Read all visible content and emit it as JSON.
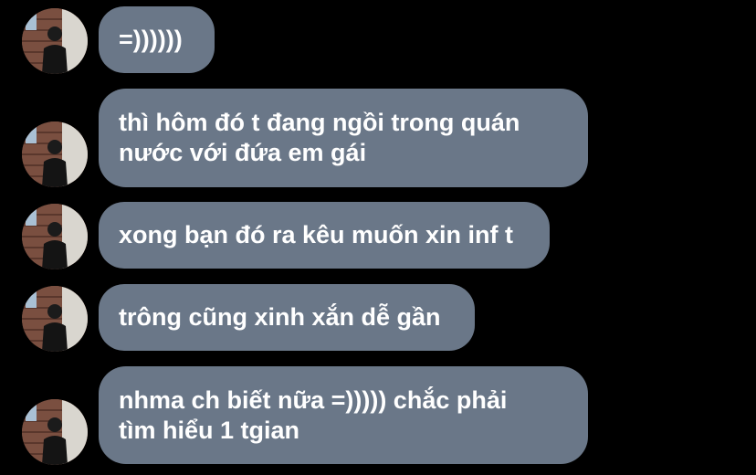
{
  "colors": {
    "background": "#000000",
    "bubble": "#6a7788",
    "text": "#ffffff"
  },
  "messages": [
    {
      "text": "=))))))",
      "avatar": "user-avatar"
    },
    {
      "text": "thì hôm đó t đang ngồi trong quán\nnước với đứa em gái",
      "avatar": "user-avatar"
    },
    {
      "text": "xong bạn đó ra kêu muốn xin inf t",
      "avatar": "user-avatar"
    },
    {
      "text": "trông cũng xinh xắn dễ gần",
      "avatar": "user-avatar"
    },
    {
      "text": "nhma ch biết nữa =))))) chắc phải\ntìm hiểu 1 tgian",
      "avatar": "user-avatar"
    }
  ]
}
